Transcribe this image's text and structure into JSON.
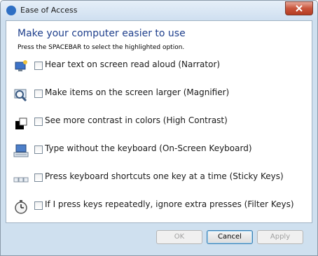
{
  "window": {
    "title": "Ease of Access"
  },
  "heading": "Make your computer easier to use",
  "instruction": "Press the SPACEBAR to select the highlighted option.",
  "options": [
    {
      "label": "Hear text on screen read aloud (Narrator)",
      "icon": "narrator-icon",
      "checked": false
    },
    {
      "label": "Make items on the screen larger (Magnifier)",
      "icon": "magnifier-icon",
      "checked": false
    },
    {
      "label": "See more contrast in colors (High Contrast)",
      "icon": "high-contrast-icon",
      "checked": false
    },
    {
      "label": "Type without the keyboard (On-Screen Keyboard)",
      "icon": "on-screen-keyboard-icon",
      "checked": false
    },
    {
      "label": "Press keyboard shortcuts one key at a time (Sticky Keys)",
      "icon": "sticky-keys-icon",
      "checked": false
    },
    {
      "label": "If I press keys repeatedly, ignore extra presses (Filter Keys)",
      "icon": "filter-keys-icon",
      "checked": false
    }
  ],
  "buttons": {
    "ok": "OK",
    "cancel": "Cancel",
    "apply": "Apply"
  },
  "colors": {
    "heading": "#1e3f8c",
    "close_button": "#c9553c",
    "title_bar": "#cfdff0"
  }
}
